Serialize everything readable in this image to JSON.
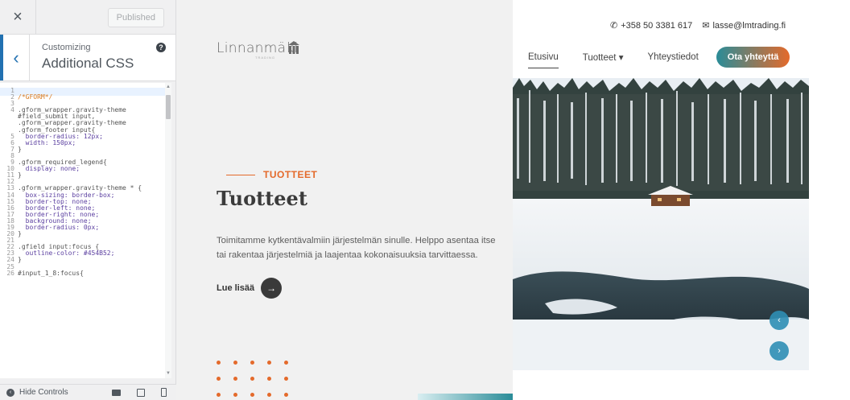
{
  "customizer": {
    "published_label": "Published",
    "section_small": "Customizing",
    "section_title": "Additional CSS",
    "hide_controls_label": "Hide Controls",
    "code_lines": [
      {
        "n": "1",
        "text": "",
        "type": ""
      },
      {
        "n": "2",
        "text": "/*GFORM*/",
        "type": "cmt"
      },
      {
        "n": "3",
        "text": "",
        "type": ""
      },
      {
        "n": "4",
        "text": ".gform_wrapper.gravity-theme",
        "type": ""
      },
      {
        "n": "",
        "text": "#field_submit input,",
        "type": ""
      },
      {
        "n": "",
        "text": ".gform_wrapper.gravity-theme",
        "type": ""
      },
      {
        "n": "",
        "text": ".gform_footer input{",
        "type": ""
      },
      {
        "n": "5",
        "text": "  border-radius: 12px;",
        "type": "kw"
      },
      {
        "n": "6",
        "text": "  width: 150px;",
        "type": "kw"
      },
      {
        "n": "7",
        "text": "}",
        "type": ""
      },
      {
        "n": "8",
        "text": "",
        "type": ""
      },
      {
        "n": "9",
        "text": ".gform_required_legend{",
        "type": ""
      },
      {
        "n": "10",
        "text": "  display: none;",
        "type": "kw"
      },
      {
        "n": "11",
        "text": "}",
        "type": ""
      },
      {
        "n": "12",
        "text": "",
        "type": ""
      },
      {
        "n": "13",
        "text": ".gform_wrapper.gravity-theme * {",
        "type": ""
      },
      {
        "n": "14",
        "text": "  box-sizing: border-box;",
        "type": "kw"
      },
      {
        "n": "15",
        "text": "  border-top: none;",
        "type": "kw"
      },
      {
        "n": "16",
        "text": "  border-left: none;",
        "type": "kw"
      },
      {
        "n": "17",
        "text": "  border-right: none;",
        "type": "kw"
      },
      {
        "n": "18",
        "text": "  background: none;",
        "type": "kw"
      },
      {
        "n": "19",
        "text": "  border-radius: 0px;",
        "type": "kw"
      },
      {
        "n": "20",
        "text": "}",
        "type": ""
      },
      {
        "n": "21",
        "text": "",
        "type": ""
      },
      {
        "n": "22",
        "text": ".gfield input:focus {",
        "type": ""
      },
      {
        "n": "23",
        "text": "  outline-color: #454B52;",
        "type": "kw"
      },
      {
        "n": "24",
        "text": "}",
        "type": ""
      },
      {
        "n": "25",
        "text": "",
        "type": ""
      },
      {
        "n": "26",
        "text": "#input_1_8:focus{",
        "type": ""
      }
    ]
  },
  "site": {
    "logo_text": "Linnanmäki",
    "logo_sub": "TRADING",
    "phone": "+358 50 3381 617",
    "email": "lasse@lmtrading.fi",
    "nav": {
      "home": "Etusivu",
      "products": "Tuotteet",
      "contact": "Yhteystiedot",
      "cta": "Ota yhteyttä"
    },
    "hero": {
      "eyebrow": "TUOTTEET",
      "title": "Tuotteet",
      "text": "Toimitamme kytkentävalmiin järjestelmän sinulle. Helppo asentaa itse tai rakentaa järjestelmiä ja laajentaa kokonaisuuksia tarvittaessa.",
      "read_more": "Lue lisää"
    }
  },
  "colors": {
    "accent_orange": "#e46a2b",
    "accent_teal": "#2a8c98",
    "wp_blue": "#2271b1"
  }
}
